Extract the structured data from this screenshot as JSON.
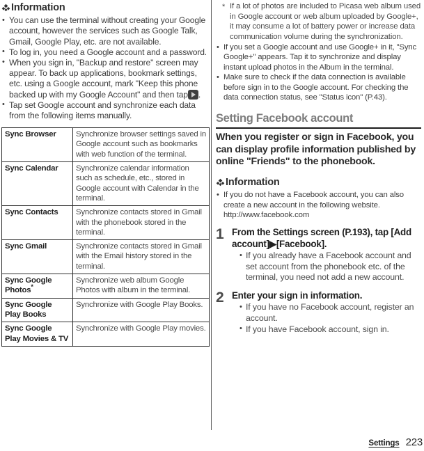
{
  "page": {
    "number": "223",
    "chapter": "Settings"
  },
  "left_column": {
    "info_heading": "Information",
    "info_bullets": [
      "You can use the terminal without creating your Google account, however the services such as Google Talk, Gmail, Google Play, etc. are not available.",
      "To log in, you need a Google account and a password.",
      "When you sign in, \"Backup and restore\" screen may appear. To back up applications, bookmark settings, etc. using a Google account, mark \"Keep this phone backed up with my Google Account\" and then tap",
      "Tap set Google account and synchronize each data from the following items manually."
    ],
    "bullet3_suffix": ".",
    "table": {
      "rows": [
        {
          "name": "Sync Browser",
          "desc": "Synchronize browser settings saved in Google account such as bookmarks with web function of the terminal."
        },
        {
          "name": "Sync Calendar",
          "desc": "Synchronize calendar information such as schedule, etc., stored in Google account with Calendar in the terminal."
        },
        {
          "name": "Sync Contacts",
          "desc": "Synchronize contacts stored in Gmail with the phonebook stored in the terminal."
        },
        {
          "name": "Sync Gmail",
          "desc": "Synchronize contacts stored in Gmail with the Email history stored in the terminal."
        },
        {
          "name": "Sync Google Photos",
          "name_star": "*",
          "desc": "Synchronize web album Google Photos with album in the terminal."
        },
        {
          "name": "Sync Google Play Books",
          "desc": "Synchronize with Google Play Books."
        },
        {
          "name": "Sync Google Play Movies & TV",
          "desc": "Synchronize with Google Play movies."
        }
      ]
    }
  },
  "right_column": {
    "footnote": "If a lot of photos are included to Picasa web album used in Google account or web album uploaded by Google+, it may consume a lot of battery power or increase data communication volume during the synchronization.",
    "bullets": [
      "If you set a Google account and use Google+ in it, \"Sync Google+\" appears. Tap it to synchronize and display instant upload photos in the Album in the terminal.",
      "Make sure to check if the data connection is available before sign in to the Google account. For checking the data connection status, see \"Status icon\" (P.43)."
    ],
    "section_title": "Setting Facebook account",
    "section_lead": "When you register or sign in Facebook, you can display profile information published by online \"Friends\" to the phonebook.",
    "info_heading": "Information",
    "info_bullets": [
      "If you do not have a Facebook account, you can also create a new account in the following website. http://www.facebook.com"
    ],
    "steps": [
      {
        "number": "1",
        "title": "From the Settings screen (P.193), tap [Add account]▶[Facebook].",
        "bullets": [
          "If you already have a Facebook account and set account from the phonebook etc. of the terminal, you need not add a new account."
        ]
      },
      {
        "number": "2",
        "title": "Enter your sign in information.",
        "bullets": [
          "If you have no Facebook account, register an account.",
          "If you have Facebook account, sign in."
        ]
      }
    ]
  },
  "colors": {
    "body_text": "#3d3d3d",
    "section_heading": "#7d7d7d",
    "rule": "#1c1c1c",
    "table_border": "#2e2e2e"
  }
}
